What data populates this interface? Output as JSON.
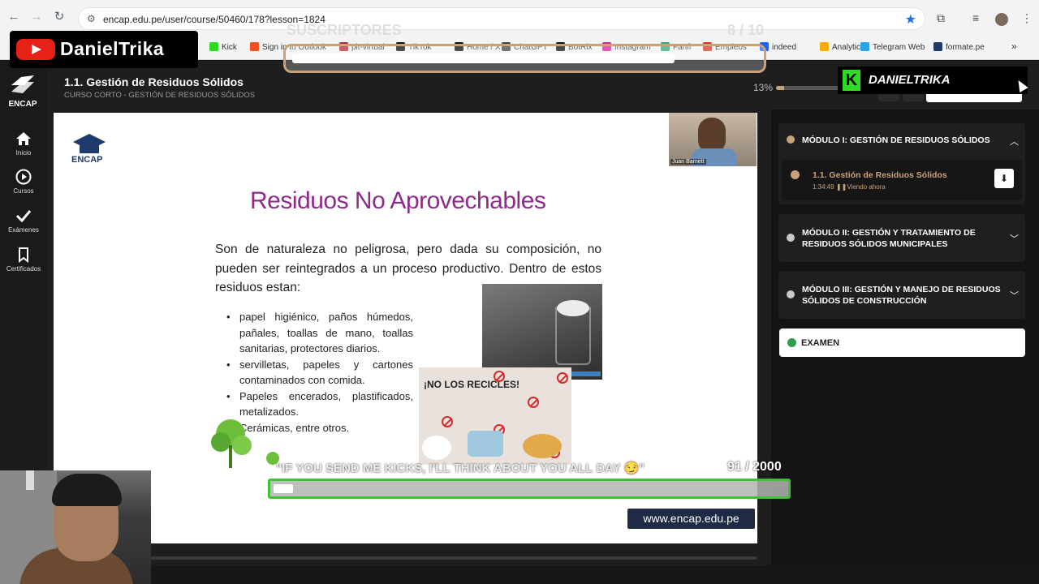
{
  "browser": {
    "url": "encap.edu.pe/user/course/50460/178?lesson=1824",
    "bookmarks": [
      {
        "label": "Kick",
        "color": "#2edb23"
      },
      {
        "label": "Sign in to Outlook",
        "color": "#f25022"
      },
      {
        "label": "pit-virtual",
        "color": "#b22a3a"
      },
      {
        "label": "TikTok",
        "color": "#111111"
      },
      {
        "label": "Home / X",
        "color": "#111111"
      },
      {
        "label": "ChatGPT",
        "color": "#444444"
      },
      {
        "label": "BotRix",
        "color": "#111111"
      },
      {
        "label": "Instagram",
        "color": "#d6249f"
      },
      {
        "label": "Fanfi",
        "color": "#3aa57a"
      },
      {
        "label": "Empleos",
        "color": "#d33a2c"
      },
      {
        "label": "indeed",
        "color": "#2164f3"
      },
      {
        "label": "Analytics",
        "color": "#f9ab00"
      },
      {
        "label": "Telegram Web",
        "color": "#2aa3e0"
      },
      {
        "label": "formate.pe",
        "color": "#1f3b6b"
      }
    ]
  },
  "header": {
    "lesson_title": "1.1. Gestión de Residuos Sólidos",
    "course_subtitle": "CURSO CORTO - GESTIÓN DE RESIDUOS SÓLIDOS",
    "progress_label": "13%",
    "progress_value": 0.13
  },
  "sidebar": {
    "logo": "ENCAP",
    "items": [
      {
        "label": "Inicio",
        "icon": "home-icon"
      },
      {
        "label": "Cursos",
        "icon": "play-circle-icon"
      },
      {
        "label": "Exámenes",
        "icon": "check-icon"
      },
      {
        "label": "Certificados",
        "icon": "bookmark-icon"
      }
    ]
  },
  "slide": {
    "logo": "ENCAP",
    "title": "Residuos No Aprovechables",
    "intro": "Son de naturaleza no peligrosa, pero dada su composición, no pueden ser reintegrados a un proceso productivo. Dentro de estos residuos estan:",
    "bullets": [
      "papel higiénico, paños húmedos, pañales, toallas de mano, toallas sanitarias, protectores diarios.",
      "servilletas, papeles y cartones contaminados con comida.",
      "Papeles encerados, plastificados, metalizados.",
      "Cerámicas, entre otros."
    ],
    "collage_text": "¡NO LOS RECICLES!",
    "website": "www.encap.edu.pe",
    "instructor_name": "Juan Barnett"
  },
  "panel": {
    "modules": [
      {
        "title": "MÓDULO I: GESTIÓN DE RESIDUOS SÓLIDOS",
        "expanded": true
      },
      {
        "title": "MÓDULO II: GESTIÓN Y TRATAMIENTO DE RESIDUOS SÓLIDOS MUNICIPALES",
        "expanded": false
      },
      {
        "title": "MÓDULO III: GESTIÓN Y MANEJO DE RESIDUOS SÓLIDOS DE CONSTRUCCIÓN",
        "expanded": false
      }
    ],
    "lesson": {
      "title": "1.1. Gestión de Residuos Sólidos",
      "duration": "1:34:49",
      "status": "Viendo ahora"
    },
    "exam_label": "EXAMEN"
  },
  "overlays": {
    "channel_name": "DanielTrika",
    "subs_label": "SUSCRIPTORES",
    "subs_count": "8 / 10",
    "subs_progress": 0.8,
    "kick_name": "DANIELTRIKA",
    "kicks_message": "\"IF YOU SEND ME KICKS, I'LL THINK ABOUT YOU ALL DAY 😏\"",
    "kicks_count": "91 / 2000",
    "kicks_progress": 0.0455
  },
  "colors": {
    "accent": "#c9a27a",
    "slide_title": "#8e2a8a",
    "kick_green": "#2edb23",
    "exam_check": "#2e9e4a"
  }
}
